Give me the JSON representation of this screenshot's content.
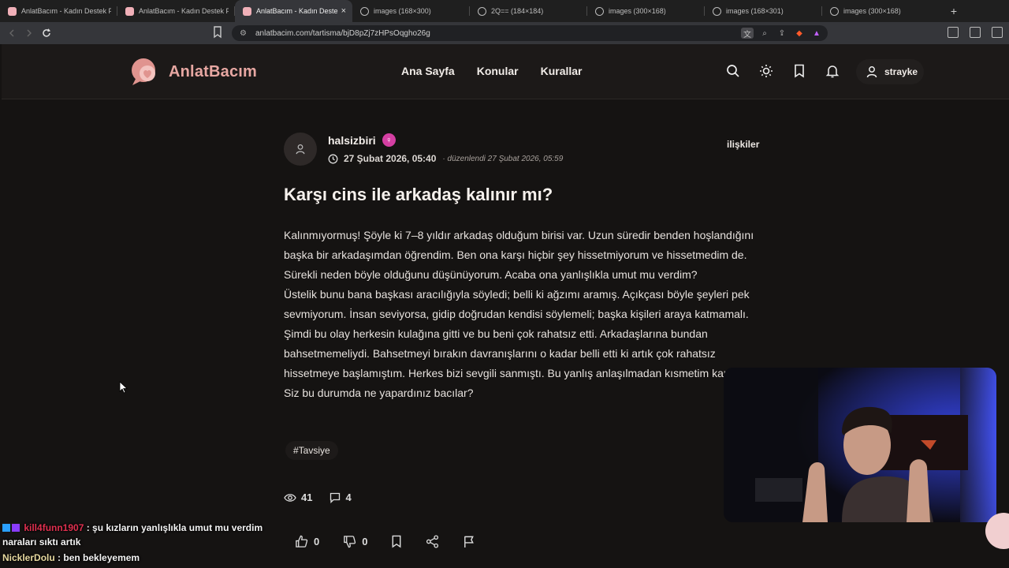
{
  "browser": {
    "tabs": [
      {
        "label": "AnlatBacım - Kadın Destek Platformu",
        "icon": "site-favicon",
        "active": false
      },
      {
        "label": "AnlatBacım - Kadın Destek Platformu",
        "icon": "site-favicon",
        "active": false
      },
      {
        "label": "AnlatBacım - Kadın Destek",
        "icon": "site-favicon",
        "active": true
      },
      {
        "label": "images (168×300)",
        "icon": "globe-icon",
        "active": false
      },
      {
        "label": "2Q== (184×184)",
        "icon": "globe-icon",
        "active": false
      },
      {
        "label": "images (300×168)",
        "icon": "globe-icon",
        "active": false
      },
      {
        "label": "images (168×301)",
        "icon": "globe-icon",
        "active": false
      },
      {
        "label": "images (300×168)",
        "icon": "globe-icon",
        "active": false
      }
    ],
    "close_glyph": "×",
    "new_tab_glyph": "+",
    "url": "anlatbacim.com/tartisma/bjD8pZj7zHPsOqgho26g"
  },
  "site": {
    "brand": "AnlatBacım",
    "brand_color": "#e7a7a2",
    "nav": [
      "Ana Sayfa",
      "Konular",
      "Kurallar"
    ],
    "username": "strayke"
  },
  "post": {
    "author": "halsizbiri",
    "gender_glyph": "♀",
    "date": "27 Şubat 2026, 05:40",
    "edited": "· düzenlendi 27 Şubat 2026, 05:59",
    "category": "ilişkiler",
    "title": "Karşı cins ile arkadaş kalınır mı?",
    "paragraphs": [
      "Kalınmıyormuş! Şöyle ki 7–8 yıldır arkadaş olduğum birisi var. Uzun süredir benden hoşlandığını başka bir arkadaşımdan öğrendim. Ben ona karşı hiçbir şey hissetmiyorum ve hissetmedim de. Sürekli neden böyle olduğunu düşünüyorum. Acaba ona yanlışlıkla umut mu verdim?",
      "Üstelik bunu bana başkası aracılığıyla söyledi; belli ki ağzımı aramış. Açıkçası böyle şeyleri pek sevmiyorum. İnsan seviyorsa, gidip doğrudan kendisi söylemeli; başka kişileri araya katmamalı. Şimdi bu olay herkesin kulağına gitti ve bu beni çok rahatsız etti. Arkadaşlarına bundan bahsetmemeliydi. Bahsetmeyi bırakın davranışlarını o kadar belli etti ki artık çok rahatsız hissetmeye başlamıştım. Herkes bizi sevgili sanmıştı. Bu yanlış anlaşılmadan kısmetim kapanmıştı. Siz bu durumda ne yapardınız bacılar?"
    ],
    "tag": "#Tavsiye",
    "views": "41",
    "comments": "4",
    "likes": "0",
    "dislikes": "0"
  },
  "chat": [
    {
      "user": "kill4funn1907",
      "text": ": şu kızların yanlışlıkla umut mu verdim naraları sıktı artık"
    },
    {
      "user": "NicklerDolu",
      "text": ": ben bekleyemem"
    }
  ]
}
